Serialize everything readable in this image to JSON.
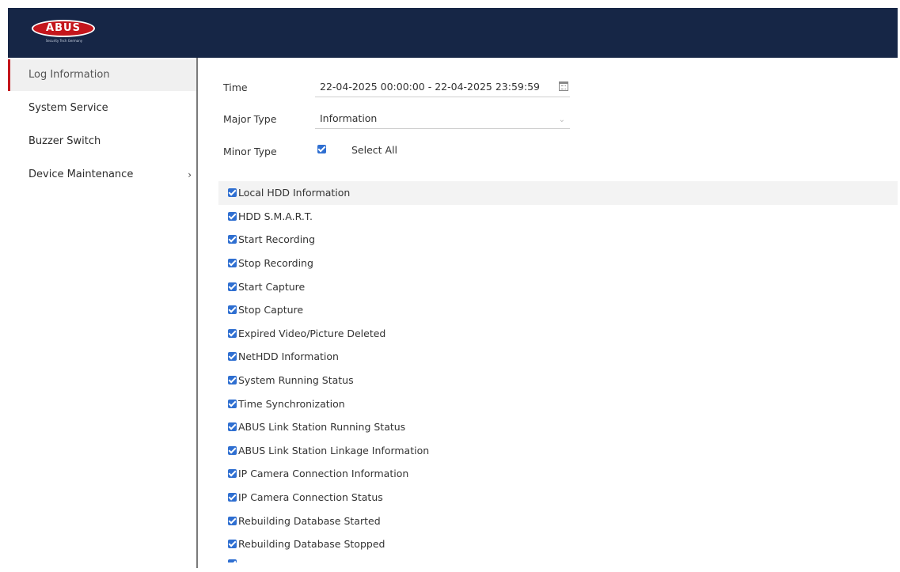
{
  "header": {
    "brand": "ABUS",
    "tagline": "Security Tech Germany"
  },
  "sidebar": {
    "items": [
      {
        "label": "Log Information",
        "active": true
      },
      {
        "label": "System Service"
      },
      {
        "label": "Buzzer Switch"
      },
      {
        "label": "Device Maintenance",
        "chevron": "›"
      }
    ]
  },
  "form": {
    "time_label": "Time",
    "time_value": "22-04-2025 00:00:00 - 22-04-2025 23:59:59",
    "major_type_label": "Major Type",
    "major_type_value": "Information",
    "minor_type_label": "Minor Type",
    "select_all_label": "Select All"
  },
  "minor_types": [
    "Local HDD Information",
    "HDD S.M.A.R.T.",
    "Start Recording",
    "Stop Recording",
    "Start Capture",
    "Stop Capture",
    "Expired Video/Picture Deleted",
    "NetHDD Information",
    "System Running Status",
    "Time Synchronization",
    "ABUS Link Station Running Status",
    "ABUS Link Station Linkage Information",
    "IP Camera Connection Information",
    "IP Camera Connection Status",
    "Rebuilding Database Started",
    "Rebuilding Database Stopped"
  ],
  "colors": {
    "header_bg": "#162646",
    "accent": "#c4161c",
    "checkbox": "#2f6fd1"
  }
}
